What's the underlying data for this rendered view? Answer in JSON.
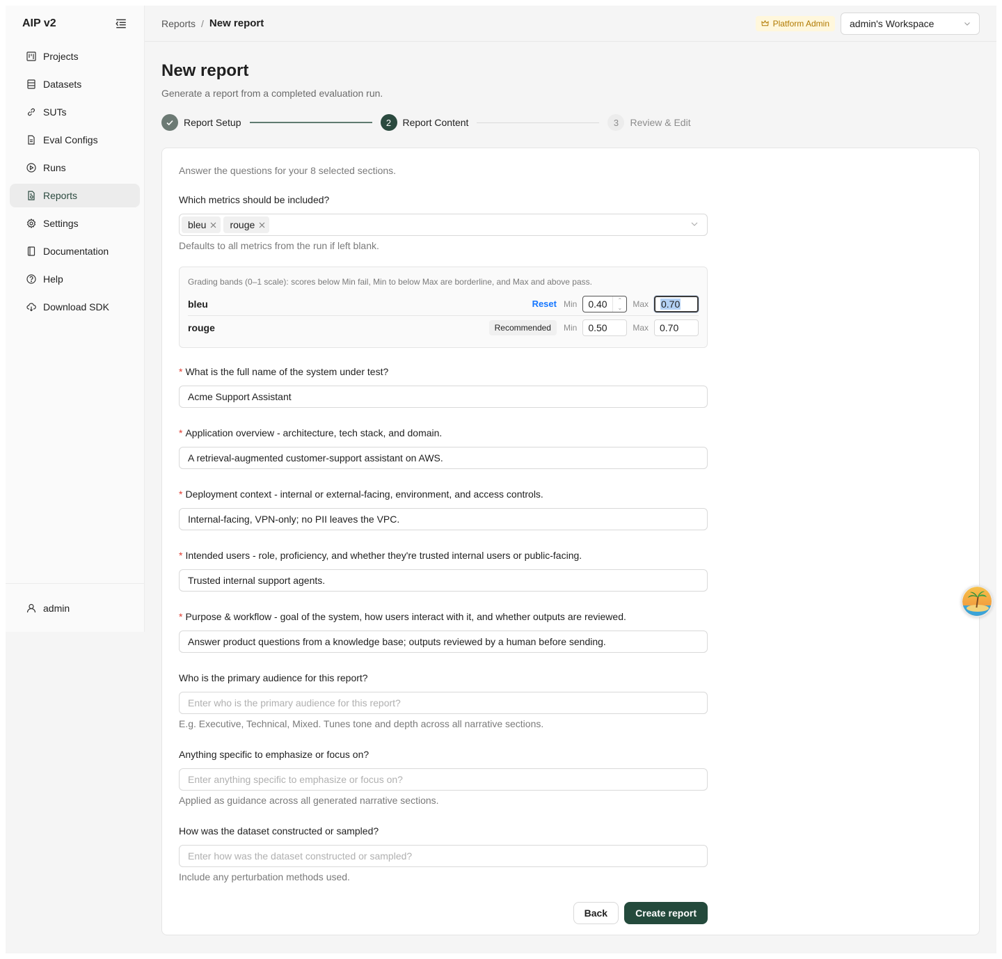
{
  "app": {
    "title": "AIP v2"
  },
  "sidebar": {
    "items": [
      {
        "label": "Projects",
        "icon": "kanban-icon"
      },
      {
        "label": "Datasets",
        "icon": "database-icon"
      },
      {
        "label": "SUTs",
        "icon": "link-icon"
      },
      {
        "label": "Eval Configs",
        "icon": "file-icon"
      },
      {
        "label": "Runs",
        "icon": "play-circle-icon"
      },
      {
        "label": "Reports",
        "icon": "report-icon",
        "active": true
      },
      {
        "label": "Settings",
        "icon": "gear-icon"
      },
      {
        "label": "Documentation",
        "icon": "book-icon"
      },
      {
        "label": "Help",
        "icon": "question-circle-icon"
      },
      {
        "label": "Download SDK",
        "icon": "cloud-download-icon"
      }
    ],
    "user": "admin"
  },
  "header": {
    "breadcrumb": {
      "parent": "Reports",
      "separator": "/",
      "current": "New report"
    },
    "badge": "Platform Admin",
    "workspace": "admin's Workspace"
  },
  "page": {
    "title": "New report",
    "subtitle": "Generate a report from a completed evaluation run."
  },
  "steps": [
    {
      "number": "1",
      "label": "Report Setup",
      "state": "done"
    },
    {
      "number": "2",
      "label": "Report Content",
      "state": "active"
    },
    {
      "number": "3",
      "label": "Review & Edit",
      "state": "pending"
    }
  ],
  "form": {
    "intro": "Answer the questions for your 8 selected sections.",
    "metrics": {
      "label": "Which metrics should be included?",
      "tags": [
        "bleu",
        "rouge"
      ],
      "help": "Defaults to all metrics from the run if left blank."
    },
    "bands": {
      "note": "Grading bands (0–1 scale): scores below Min fail, Min to below Max are borderline, and Max and above pass.",
      "min_label": "Min",
      "max_label": "Max",
      "reset_label": "Reset",
      "recommended_label": "Recommended",
      "rows": [
        {
          "name": "bleu",
          "min": "0.40",
          "max": "0.70"
        },
        {
          "name": "rouge",
          "min": "0.50",
          "max": "0.70"
        }
      ]
    },
    "questions": [
      {
        "label": "What is the full name of the system under test?",
        "required": "*",
        "value": "Acme Support Assistant"
      },
      {
        "label": "Application overview - architecture, tech stack, and domain.",
        "required": "*",
        "value": "A retrieval-augmented customer-support assistant on AWS."
      },
      {
        "label": "Deployment context - internal or external-facing, environment, and access controls.",
        "required": "*",
        "value": "Internal-facing, VPN-only; no PII leaves the VPC."
      },
      {
        "label": "Intended users - role, proficiency, and whether they're trusted internal users or public-facing.",
        "required": "*",
        "value": "Trusted internal support agents."
      },
      {
        "label": "Purpose & workflow - goal of the system, how users interact with it, and whether outputs are reviewed.",
        "required": "*",
        "value": "Answer product questions from a knowledge base; outputs reviewed by a human before sending."
      }
    ],
    "optional": [
      {
        "label": "Who is the primary audience for this report?",
        "placeholder": "Enter who is the primary audience for this report?",
        "help": "E.g. Executive, Technical, Mixed. Tunes tone and depth across all narrative sections."
      },
      {
        "label": "Anything specific to emphasize or focus on?",
        "placeholder": "Enter anything specific to emphasize or focus on?",
        "help": "Applied as guidance across all generated narrative sections."
      },
      {
        "label": "How was the dataset constructed or sampled?",
        "placeholder": "Enter how was the dataset constructed or sampled?",
        "help": "Include any perturbation methods used."
      }
    ],
    "actions": {
      "back": "Back",
      "create": "Create report"
    }
  },
  "colors": {
    "accent": "#2b4a3f",
    "primary_button": "#244a3c",
    "link": "#1677ff",
    "required": "#e03c31",
    "badge_bg": "#fff7dc",
    "badge_text": "#b07900"
  }
}
